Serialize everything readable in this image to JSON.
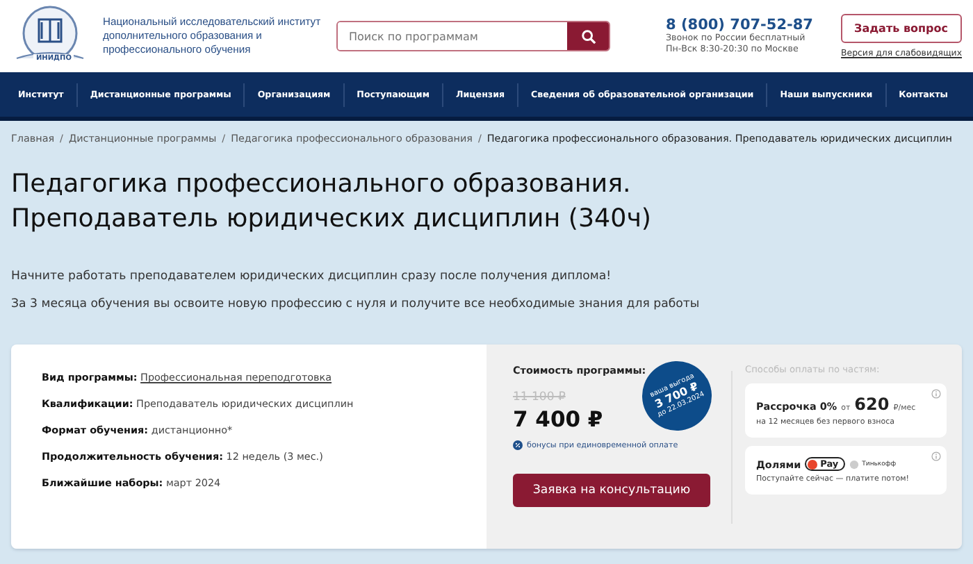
{
  "header": {
    "logo_caption": "ИНИДПО",
    "org_name": "Национальный исследовательский институт дополнительного образования и профессионального обучения",
    "search": {
      "placeholder": "Поиск по программам"
    },
    "phone": "8 (800) 707-52-87",
    "phone_note": "Звонок по России бесплатный",
    "hours": "Пн-Вск 8:30-20:30 по Москве",
    "ask_button": "Задать вопрос",
    "low_vision_link": "Версия для слабовидящих"
  },
  "nav": [
    "Институт",
    "Дистанционные программы",
    "Организациям",
    "Поступающим",
    "Лицензия",
    "Сведения об образовательной организации",
    "Наши выпускники",
    "Контакты"
  ],
  "breadcrumb_separator": "/",
  "breadcrumbs": [
    {
      "label": "Главная",
      "current": false
    },
    {
      "label": "Дистанционные программы",
      "current": false
    },
    {
      "label": "Педагогика профессионального образования",
      "current": false
    },
    {
      "label": "Педагогика профессионального образования. Преподаватель юридических дисциплин",
      "current": true
    }
  ],
  "title_lines": [
    "Педагогика профессионального образования.",
    "Преподаватель юридических дисциплин (340ч)"
  ],
  "intro": [
    "Начните работать преподавателем юридических дисциплин сразу после получения диплома!",
    "За 3 месяца обучения вы освоите новую профессию с нуля и получите все необходимые знания для работы"
  ],
  "details": [
    {
      "label": "Вид программы:",
      "value": "Профессиональная переподготовка",
      "kind": "link"
    },
    {
      "label": "Квалификации:",
      "value": "Преподаватель юридических дисциплин",
      "kind": "text"
    },
    {
      "label": "Формат обучения:",
      "value": "дистанционно*",
      "kind": "text"
    },
    {
      "label": "Продолжительность обучения:",
      "value": "12 недель (3 мес.)",
      "kind": "text"
    },
    {
      "label": "Ближайшие наборы:",
      "value": "март 2024",
      "kind": "text"
    }
  ],
  "price": {
    "label": "Стоимость программы:",
    "old": "11 100 ₽",
    "current": "7 400 ₽",
    "badge": [
      "ваша выгода",
      "3 700 ₽",
      "до 22.03.2024"
    ],
    "bonus": "бонусы при единовременной оплате",
    "button": "Заявка на консультацию"
  },
  "payment": {
    "title": "Способы оплаты по частям:",
    "installment": {
      "name": "Рассрочка 0%",
      "from": "от",
      "amount": "620",
      "unit": "₽/мес",
      "note": "на 12 месяцев без первого взноса"
    },
    "dolyami": {
      "name": "Долями",
      "pay": "Pay",
      "bank": "Тинькофф",
      "note": "Поступайте сейчас — платите потом!"
    }
  }
}
